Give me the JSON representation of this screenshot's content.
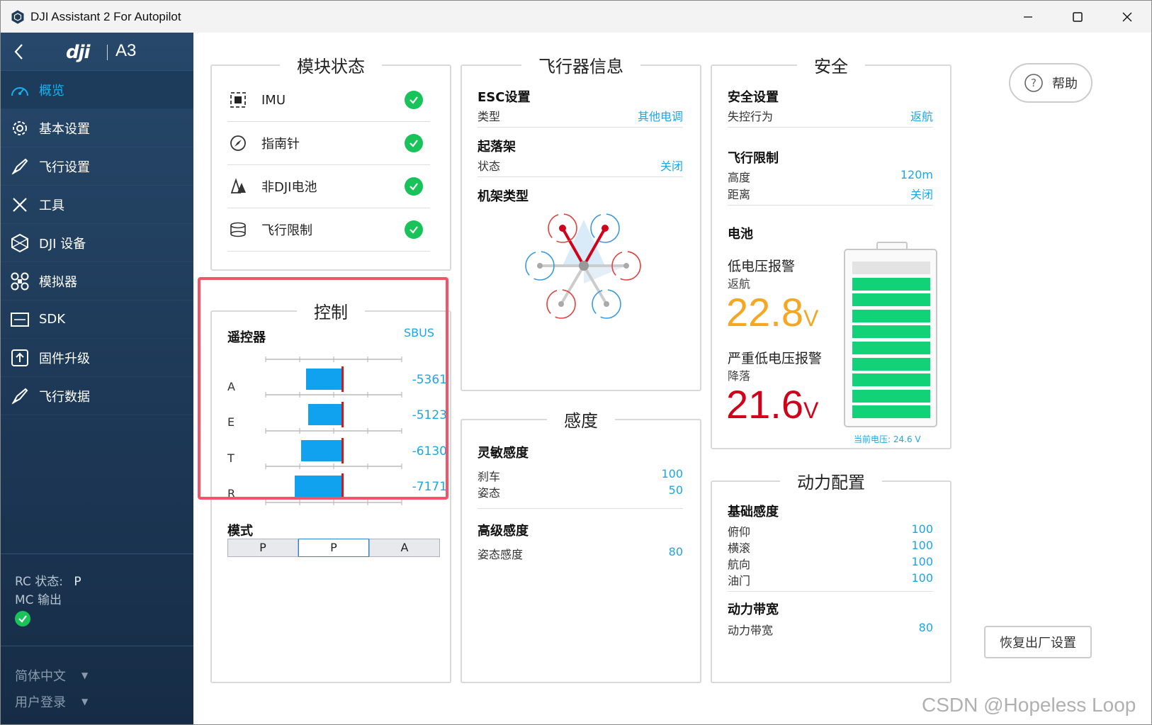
{
  "window": {
    "title": "DJI Assistant 2 For Autopilot"
  },
  "brand": {
    "logo": "dji",
    "model": "A3"
  },
  "nav": [
    {
      "label": "概览",
      "icon": "dashboard-icon",
      "active": true
    },
    {
      "label": "基本设置",
      "icon": "gear-icon"
    },
    {
      "label": "飞行设置",
      "icon": "rocket-icon"
    },
    {
      "label": "工具",
      "icon": "tools-icon"
    },
    {
      "label": "DJI 设备",
      "icon": "device-icon"
    },
    {
      "label": "模拟器",
      "icon": "drone-icon"
    },
    {
      "label": "SDK",
      "icon": "sdk-icon"
    },
    {
      "label": "固件升级",
      "icon": "firmware-icon"
    },
    {
      "label": "飞行数据",
      "icon": "flight-data-icon"
    }
  ],
  "status": {
    "rc_label": "RC 状态:",
    "rc_value": "P",
    "mc_label": "MC 输出"
  },
  "footer": {
    "language": "简体中文",
    "login": "用户登录"
  },
  "modules": {
    "title": "模块状态",
    "items": [
      {
        "label": "IMU",
        "icon": "imu-icon"
      },
      {
        "label": "指南针",
        "icon": "compass-icon"
      },
      {
        "label": "非DJI电池",
        "icon": "battery-icon"
      },
      {
        "label": "飞行限制",
        "icon": "flight-limit-icon"
      }
    ]
  },
  "control": {
    "title": "控制",
    "rc_label": "遥控器",
    "rc_type": "SBUS",
    "channels": [
      {
        "name": "A",
        "value": "-5361",
        "fraction": 0.52
      },
      {
        "name": "E",
        "value": "-5123",
        "fraction": 0.49
      },
      {
        "name": "T",
        "value": "-6130",
        "fraction": 0.59
      },
      {
        "name": "R",
        "value": "-7171",
        "fraction": 0.69
      }
    ],
    "mode_label": "模式",
    "modes": [
      "P",
      "P",
      "A"
    ],
    "selected_mode": 1
  },
  "aircraft": {
    "title": "飞行器信息",
    "esc": {
      "heading": "ESC设置",
      "type_label": "类型",
      "type_value": "其他电调"
    },
    "gear": {
      "heading": "起落架",
      "state_label": "状态",
      "state_value": "关闭"
    },
    "frame": {
      "heading": "机架类型"
    }
  },
  "sensitivity": {
    "title": "感度",
    "basic": {
      "heading": "灵敏感度",
      "brake_label": "刹车",
      "brake_value": "100",
      "attitude_label": "姿态",
      "attitude_value": "50"
    },
    "advanced": {
      "heading": "高级感度",
      "att_label": "姿态感度",
      "att_value": "80"
    }
  },
  "safety": {
    "title": "安全",
    "settings": {
      "heading": "安全设置",
      "failsafe_label": "失控行为",
      "failsafe_value": "返航"
    },
    "limits": {
      "heading": "飞行限制",
      "height_label": "高度",
      "height_value": "120m",
      "distance_label": "距离",
      "distance_value": "关闭"
    },
    "battery": {
      "heading": "电池",
      "low_label": "低电压报警",
      "low_action": "返航",
      "low_value": "22.8",
      "low_unit": "V",
      "crit_label": "严重低电压报警",
      "crit_action": "降落",
      "crit_value": "21.6",
      "crit_unit": "V",
      "current": "当前电压: 24.6 V",
      "cells_filled": 9,
      "cells_total": 10
    }
  },
  "power": {
    "title": "动力配置",
    "basic": {
      "heading": "基础感度",
      "rows": [
        {
          "label": "俯仰",
          "value": "100"
        },
        {
          "label": "横滚",
          "value": "100"
        },
        {
          "label": "航向",
          "value": "100"
        },
        {
          "label": "油门",
          "value": "100"
        }
      ]
    },
    "bandwidth": {
      "heading": "动力带宽",
      "label": "动力带宽",
      "value": "80"
    }
  },
  "buttons": {
    "help": "帮助",
    "reset": "恢复出厂设置"
  },
  "watermark": "CSDN @Hopeless Loop",
  "colors": {
    "accent": "#1aa7e8",
    "sidebar": "#1d3856",
    "ok": "#18c35a",
    "warn": "#f5a623",
    "danger": "#d0021b",
    "highlight": "#f25567"
  }
}
